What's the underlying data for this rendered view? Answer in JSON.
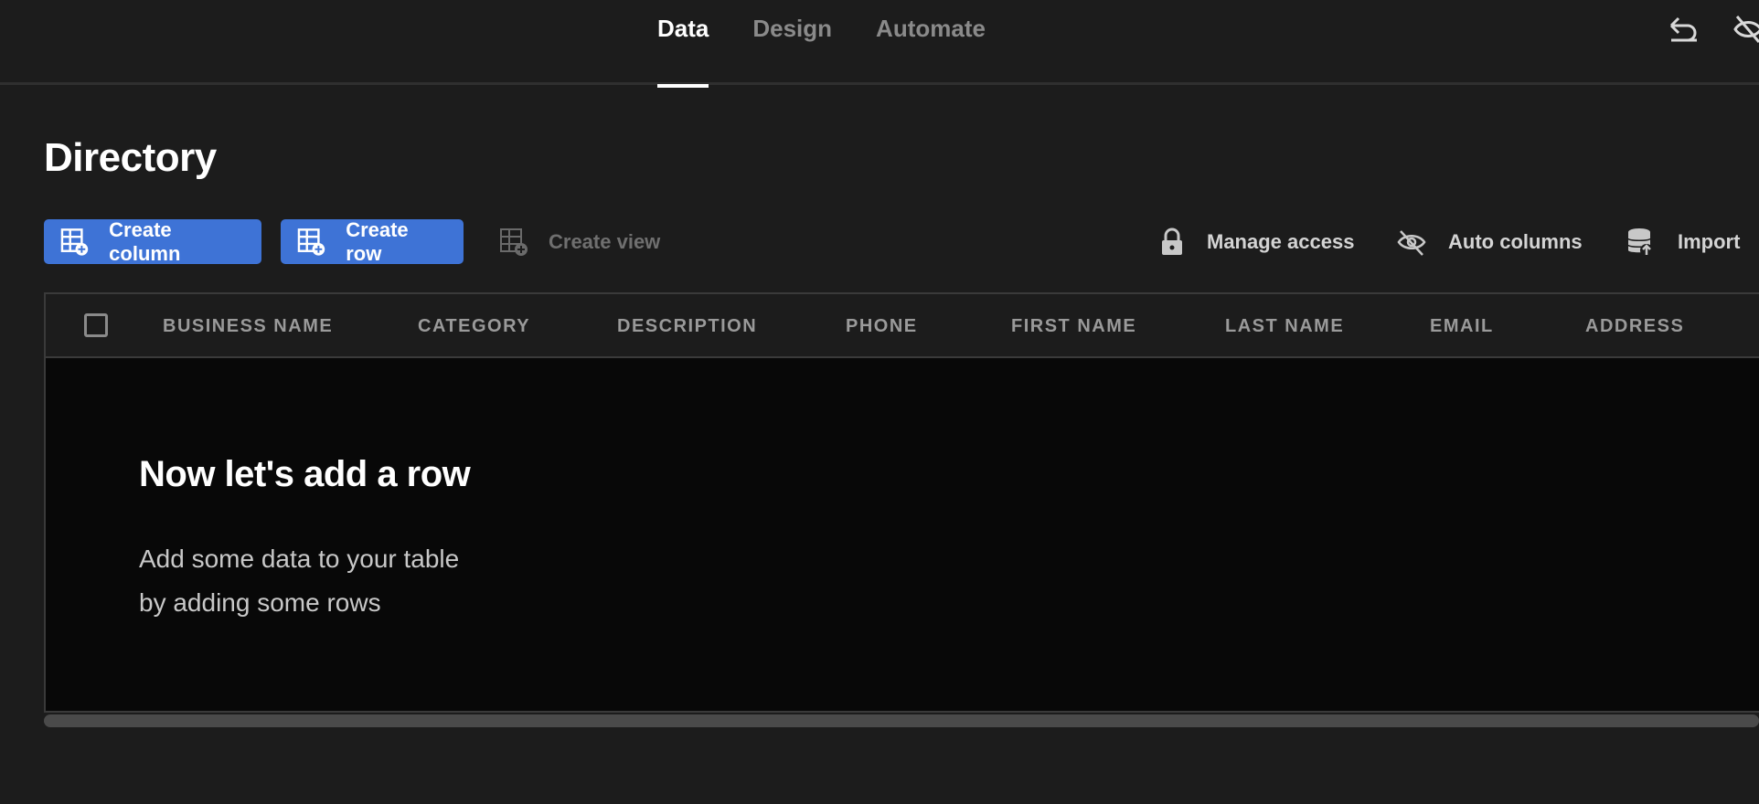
{
  "nav": {
    "tabs": [
      {
        "label": "Data",
        "active": true
      },
      {
        "label": "Design",
        "active": false
      },
      {
        "label": "Automate",
        "active": false
      }
    ],
    "icons": [
      "undo-icon",
      "visibility-off-icon"
    ]
  },
  "page": {
    "title": "Directory"
  },
  "toolbar": {
    "create_column": "Create column",
    "create_row": "Create row",
    "create_view": "Create view",
    "manage_access": "Manage access",
    "auto_columns": "Auto columns",
    "import": "Import"
  },
  "table": {
    "columns": [
      "BUSINESS NAME",
      "CATEGORY",
      "DESCRIPTION",
      "PHONE",
      "FIRST NAME",
      "LAST NAME",
      "EMAIL",
      "ADDRESS"
    ]
  },
  "empty_state": {
    "title": "Now let's add a row",
    "description_line1": "Add some data to your table",
    "description_line2": "by adding some rows"
  },
  "colors": {
    "background": "#1c1c1c",
    "primary": "#3e73d6",
    "table_body": "#080808"
  }
}
